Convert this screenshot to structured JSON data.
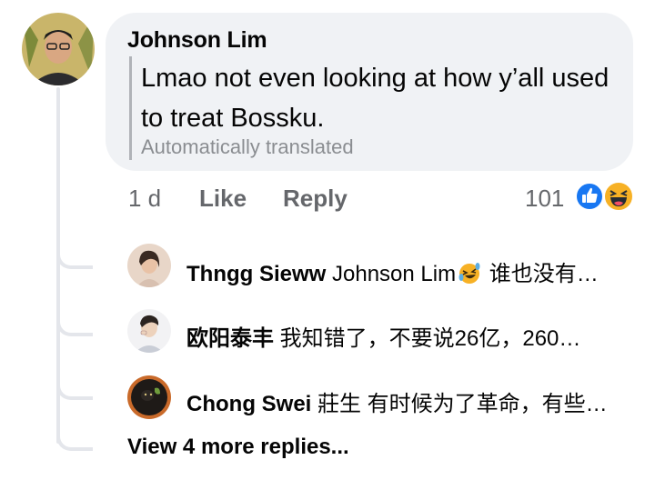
{
  "comment": {
    "author": "Johnson Lim",
    "text": "Lmao not even looking at how y’all used to treat Bossku.",
    "translated_note": "Automatically translated",
    "time": "1 d",
    "like_label": "Like",
    "reply_label": "Reply",
    "reaction_count": "101",
    "reaction_icons": [
      "like-icon",
      "haha-icon"
    ]
  },
  "replies": [
    {
      "name": "Thngg Sieww",
      "mention": "Johnson Lim",
      "emoji": "laughing-crying-icon",
      "text": "谁也没有…"
    },
    {
      "name": "欧阳泰丰",
      "text": "我知错了，不要说26亿，260…"
    },
    {
      "name": "Chong Swei",
      "text": "莊生 有时候为了革命，有些…"
    }
  ],
  "view_more": "View 4 more replies...",
  "colors": {
    "bubble": "#f0f2f5",
    "muted": "#65676b",
    "like_blue": "#1877f2",
    "haha_yellow": "#f7b125",
    "thread": "#e4e6eb"
  }
}
